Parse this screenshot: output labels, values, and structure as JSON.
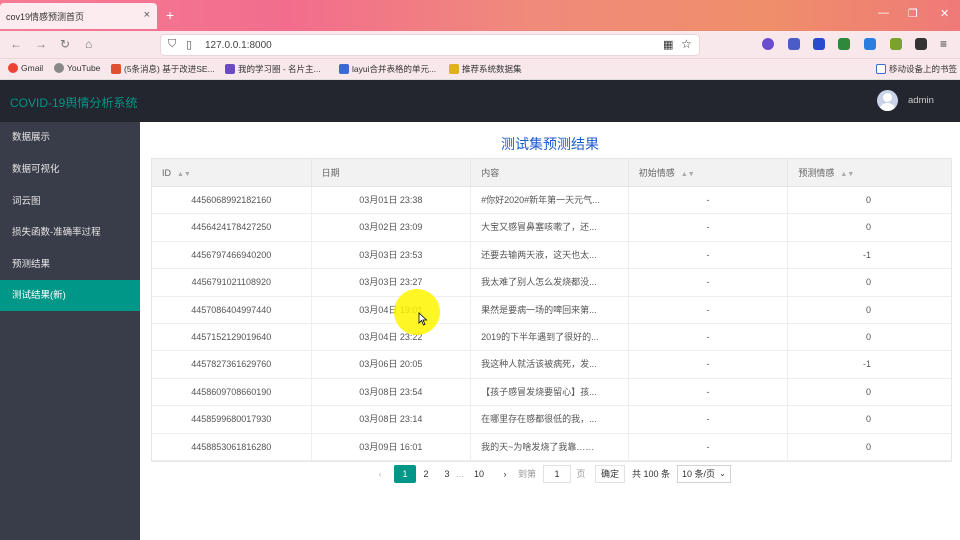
{
  "browser": {
    "tab_title": "cov19情感预测首页",
    "tab_close": "×",
    "new_tab": "+",
    "url": "127.0.0.1:8000",
    "bookmarks": [
      {
        "label": "Gmail",
        "color": "#ea4335"
      },
      {
        "label": "YouTube",
        "color": "#888888"
      },
      {
        "label": "(5条消息) 基于改进SE...",
        "color": "#e05030"
      },
      {
        "label": "我的学习圈 - 名片主...",
        "color": "#6a4bc4"
      },
      {
        "label": "layui合并表格的单元...",
        "color": "#3a6ad4"
      },
      {
        "label": "推荐系统数据集",
        "color": "#e0b020"
      }
    ],
    "mobile_bookmarks": "移动设备上的书签"
  },
  "header": {
    "app_title": "COVID-19舆情分析系统",
    "user": "admin"
  },
  "sidebar": {
    "items": [
      {
        "label": "数据展示"
      },
      {
        "label": "数据可视化"
      },
      {
        "label": "词云图"
      },
      {
        "label": "损失函数-准确率过程"
      },
      {
        "label": "预测结果"
      },
      {
        "label": "测试结果(新)"
      }
    ],
    "active_index": 5
  },
  "main": {
    "title": "测试集预测结果",
    "columns": [
      "ID",
      "日期",
      "内容",
      "初始情感",
      "预测情感"
    ],
    "sort_icon": "▲▼",
    "rows": [
      {
        "id": "4456068992182160",
        "date": "03月01日 23:38",
        "content": "#你好2020#新年第一天元气...",
        "initial": "-",
        "predicted": "0"
      },
      {
        "id": "4456424178427250",
        "date": "03月02日 23:09",
        "content": "大宝又感冒鼻塞咳嗽了，还...",
        "initial": "-",
        "predicted": "0"
      },
      {
        "id": "4456797466940200",
        "date": "03月03日 23:53",
        "content": "还要去输两天液，这天也太...",
        "initial": "-",
        "predicted": "-1"
      },
      {
        "id": "4456791021108920",
        "date": "03月03日 23:27",
        "content": "我太难了别人怎么发烧都没...",
        "initial": "-",
        "predicted": "0"
      },
      {
        "id": "4457086404997440",
        "date": "03月04日 19:01",
        "content": "果然是要病一场的啤回来第...",
        "initial": "-",
        "predicted": "0"
      },
      {
        "id": "4457152129019640",
        "date": "03月04日 23:22",
        "content": "2019的下半年遇到了很好的...",
        "initial": "-",
        "predicted": "0"
      },
      {
        "id": "4457827361629760",
        "date": "03月06日 20:05",
        "content": "我这种人就活该被病死，发...",
        "initial": "-",
        "predicted": "-1"
      },
      {
        "id": "4458609708660190",
        "date": "03月08日 23:54",
        "content": "【孩子感冒发烧要留心】孩...",
        "initial": "-",
        "predicted": "0"
      },
      {
        "id": "4458599680017930",
        "date": "03月08日 23:14",
        "content": "在哪里存在感都很低的我，...",
        "initial": "-",
        "predicted": "0"
      },
      {
        "id": "4458853061816280",
        "date": "03月09日 16:01",
        "content": "我的天~为啥发烧了我靠……",
        "initial": "-",
        "predicted": "0"
      }
    ]
  },
  "pager": {
    "prev": "‹",
    "pages": [
      "1",
      "2",
      "3",
      "…",
      "10"
    ],
    "current": "1",
    "next": "›",
    "goto_label": "到第",
    "goto_value": "1",
    "page_unit": "页",
    "confirm": "确定",
    "total": "共 100 条",
    "page_size": "10 条/页"
  }
}
